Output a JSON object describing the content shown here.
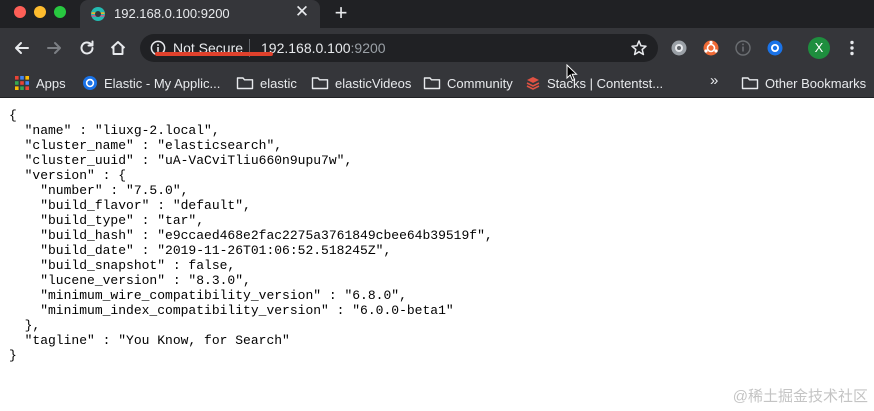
{
  "window": {
    "traffic_lights": [
      "close",
      "minimize",
      "zoom"
    ]
  },
  "tab": {
    "title": "192.168.0.100:9200",
    "favicon": "elastic-globe-icon",
    "close_glyph": "✕",
    "new_tab_glyph": "+"
  },
  "toolbar": {
    "security_label": "Not Secure",
    "url_host": "192.168.0.100",
    "url_port": ":9200",
    "icons": [
      "back-icon",
      "forward-icon",
      "reload-icon",
      "home-icon",
      "info-icon",
      "star-icon",
      "extension-icon",
      "extension-icon",
      "extension-icon",
      "extension-icon",
      "avatar",
      "menu-icon"
    ],
    "avatar_letter": "X"
  },
  "bookmarks": {
    "items": [
      {
        "label": "Apps",
        "icon": "apps-grid-icon"
      },
      {
        "label": "Elastic - My Applic...",
        "icon": "chrome-site-icon"
      },
      {
        "label": "elastic",
        "icon": "folder-icon"
      },
      {
        "label": "elasticVideos",
        "icon": "folder-icon"
      },
      {
        "label": "Community",
        "icon": "folder-icon"
      },
      {
        "label": "Stacks | Contentst...",
        "icon": "stack-icon"
      }
    ],
    "overflow_glyph": "»",
    "other_label": "Other Bookmarks"
  },
  "content": {
    "lines": [
      "{",
      "  \"name\" : \"liuxg-2.local\",",
      "  \"cluster_name\" : \"elasticsearch\",",
      "  \"cluster_uuid\" : \"uA-VaCviTliu660n9upu7w\",",
      "  \"version\" : {",
      "    \"number\" : \"7.5.0\",",
      "    \"build_flavor\" : \"default\",",
      "    \"build_type\" : \"tar\",",
      "    \"build_hash\" : \"e9ccaed468e2fac2275a3761849cbee64b39519f\",",
      "    \"build_date\" : \"2019-11-26T01:06:52.518245Z\",",
      "    \"build_snapshot\" : false,",
      "    \"lucene_version\" : \"8.3.0\",",
      "    \"minimum_wire_compatibility_version\" : \"6.8.0\",",
      "    \"minimum_index_compatibility_version\" : \"6.0.0-beta1\"",
      "  },",
      "  \"tagline\" : \"You Know, for Search\"",
      "}"
    ]
  },
  "watermark": "@稀土掘金技术社区",
  "colors": {
    "tabstrip": "#202124",
    "toolbar": "#35363a",
    "url_underline": "#e0412c"
  }
}
